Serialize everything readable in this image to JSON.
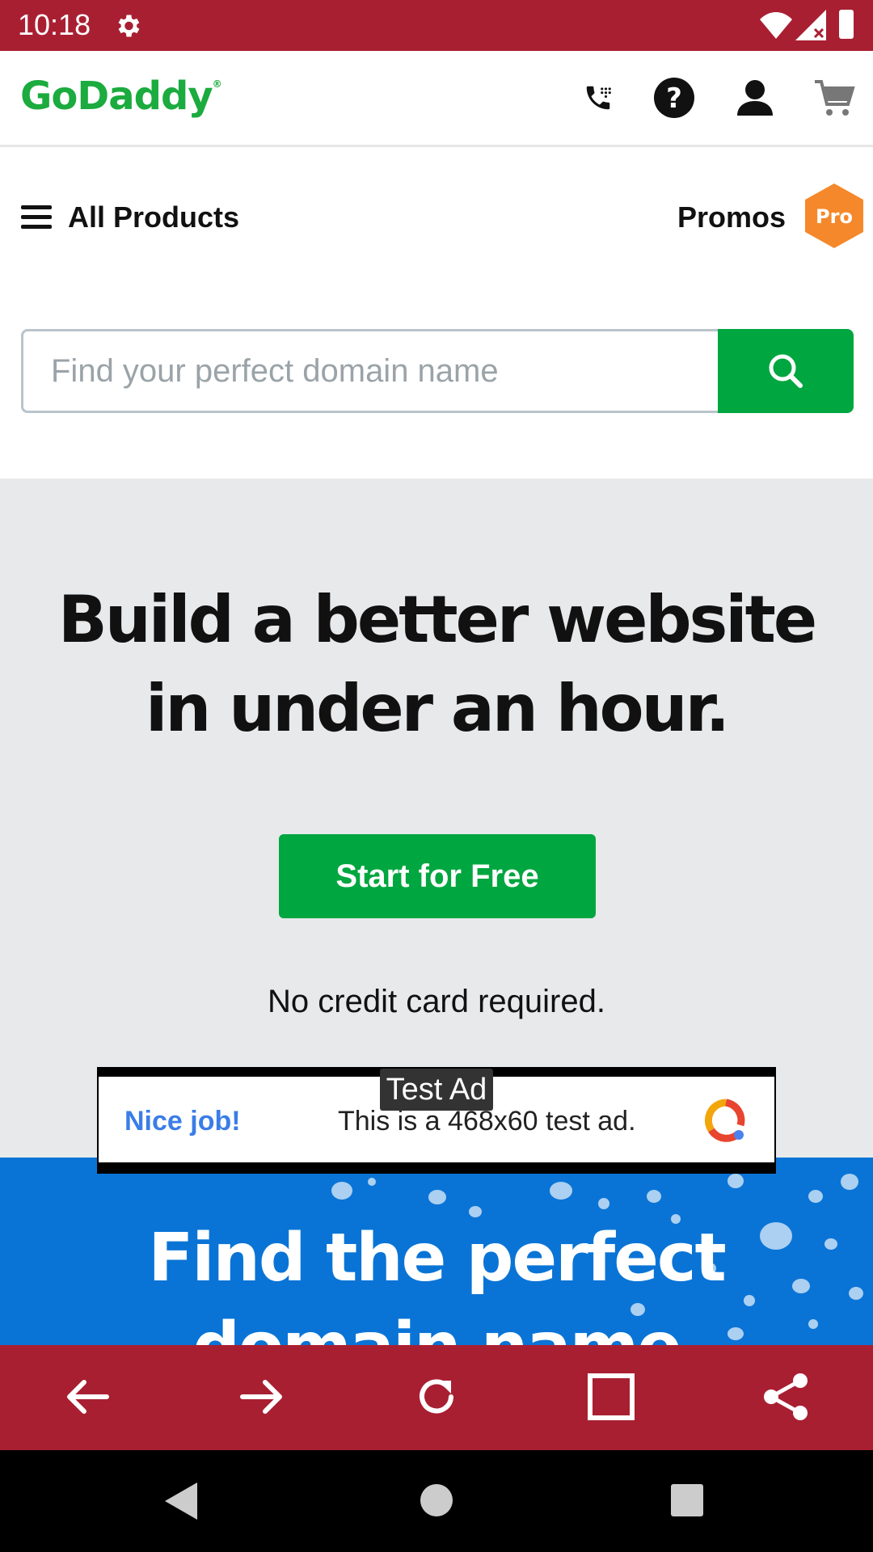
{
  "status_bar": {
    "time": "10:18"
  },
  "header": {
    "logo": "GoDaddy",
    "logo_mark": "®"
  },
  "nav": {
    "all_products": "All Products",
    "promos": "Promos",
    "pro_badge": "Pro"
  },
  "search": {
    "placeholder": "Find your perfect domain name"
  },
  "hero": {
    "title_line1": "Build a better website",
    "title_line2": "in under an hour.",
    "cta": "Start for Free",
    "note": "No credit card required."
  },
  "ad": {
    "label": "Test Ad",
    "nice": "Nice job!",
    "text": "This is a 468x60 test ad."
  },
  "domain_section": {
    "title_line1": "Find the perfect",
    "title_line2": "domain name"
  },
  "colors": {
    "status_bar": "#a91f32",
    "brand_green": "#1bab3e",
    "button_green": "#00a63f",
    "hero_bg": "#e8e9eb",
    "domain_blue": "#0a74d6"
  }
}
